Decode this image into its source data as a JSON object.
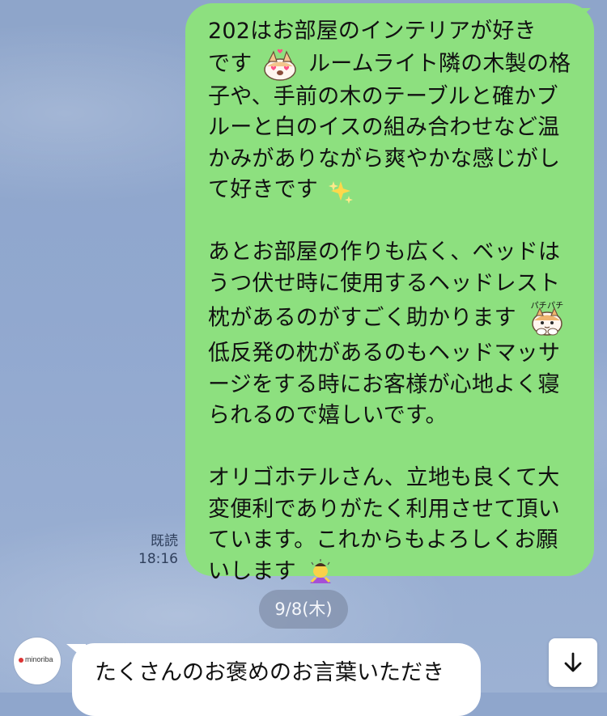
{
  "thread": {
    "outgoing": {
      "lines": [
        "202はお部屋のインテリアが好き",
        "です",
        "ルームライト隣の木製の格",
        "子や、手前の木のテーブルと確かブ",
        "ルーと白のイスの組み合わせなど温",
        "かみがありながら爽やかな感じがし",
        "て好きです",
        "あとお部屋の作りも広く、ベッドは",
        "うつ伏せ時に使用するヘッドレスト",
        "枕があるのがすごく助かります",
        "低反発の枕があるのもヘッドマッサ",
        "ージをする時にお客様が心地よく寝",
        "られるので嬉しいです。",
        "オリゴホテルさん、立地も良くて大",
        "変便利でありがたく利用させて頂い",
        "ています。これからもよろしくお願",
        "いします"
      ],
      "read_label": "既読",
      "time": "18:16"
    },
    "date_separator": "9/8(木)",
    "incoming": {
      "avatar_text": "minoriba",
      "line1": "たくさんのお褒めのお言葉いただき"
    }
  },
  "stickers": {
    "cat_love": "cat-love-sticker-icon",
    "sparkles": "sparkles-icon",
    "cat_clap": "cat-clap-sticker-icon",
    "bow": "bowing-person-icon",
    "clap_text": "パチパチ"
  },
  "controls": {
    "scroll_down_icon": "arrow-down-icon"
  },
  "colors": {
    "outgoing_bubble": "#8de07f",
    "incoming_bubble": "#ffffff",
    "background": "#8fa6cc"
  }
}
